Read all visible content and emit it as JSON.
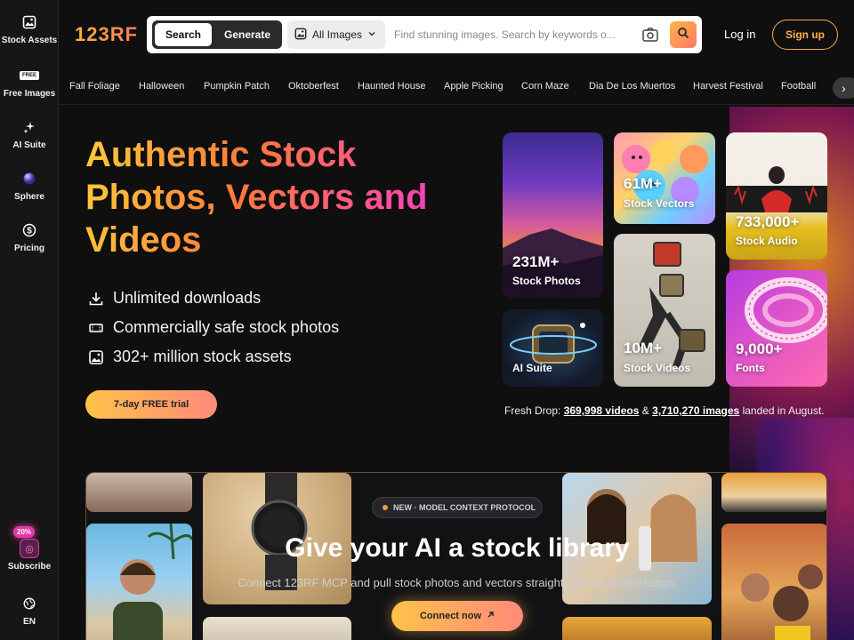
{
  "sidebar": {
    "items": [
      {
        "label": "Stock Assets",
        "icon": "image-icon"
      },
      {
        "label": "Free Images",
        "icon": "free-badge-icon",
        "badge": "FREE"
      },
      {
        "label": "AI Suite",
        "icon": "sparkle-icon"
      },
      {
        "label": "Sphere",
        "icon": "sphere-icon"
      },
      {
        "label": "Pricing",
        "icon": "dollar-icon"
      }
    ],
    "subscribe": {
      "label": "Subscribe",
      "badge": "20%"
    },
    "language": {
      "label": "EN",
      "icon": "globe-icon"
    }
  },
  "header": {
    "logo": "123RF",
    "search_toggle": {
      "search_label": "Search",
      "generate_label": "Generate"
    },
    "type_select": {
      "value": "All Images"
    },
    "search_placeholder": "Find stunning images. Search by keywords o...",
    "login_label": "Log in",
    "signup_label": "Sign up"
  },
  "categories": [
    "Fall Foliage",
    "Halloween",
    "Pumpkin Patch",
    "Oktoberfest",
    "Haunted House",
    "Apple Picking",
    "Corn Maze",
    "Dia De Los Muertos",
    "Harvest Festival",
    "Football"
  ],
  "hero": {
    "headline": "Authentic Stock Photos, Vectors and Videos",
    "features": [
      {
        "text": "Unlimited downloads",
        "icon": "download-icon"
      },
      {
        "text": "Commercially safe stock photos",
        "icon": "ticket-icon"
      },
      {
        "text": "302+ million stock assets",
        "icon": "images-icon"
      }
    ],
    "trial_label": "7-day FREE trial"
  },
  "cards": {
    "photos": {
      "count": "231M+",
      "label": "Stock Photos"
    },
    "vectors": {
      "count": "61M+",
      "label": "Stock Vectors"
    },
    "audio": {
      "count": "733,000+",
      "label": "Stock Audio"
    },
    "ai": {
      "label": "AI Suite"
    },
    "videos": {
      "count": "10M+",
      "label": "Stock Videos"
    },
    "fonts": {
      "count": "9,000+",
      "label": "Fonts"
    }
  },
  "fresh_drop": {
    "prefix": "Fresh Drop:",
    "videos": "369,998 videos",
    "and": "&",
    "images": "3,710,270 images",
    "suffix": "landed in August."
  },
  "banner": {
    "pill": "NEW · MODEL CONTEXT PROTOCOL",
    "title": "Give your AI a stock library",
    "subtitle": "Connect 123RF MCP and pull stock photos and vectors straight into the conversation.",
    "cta": "Connect now"
  },
  "colors": {
    "accent_start": "#ffc24a",
    "accent_end": "#ff8a7a",
    "signup_border": "#ffaa44",
    "background": "#0f0f10"
  }
}
